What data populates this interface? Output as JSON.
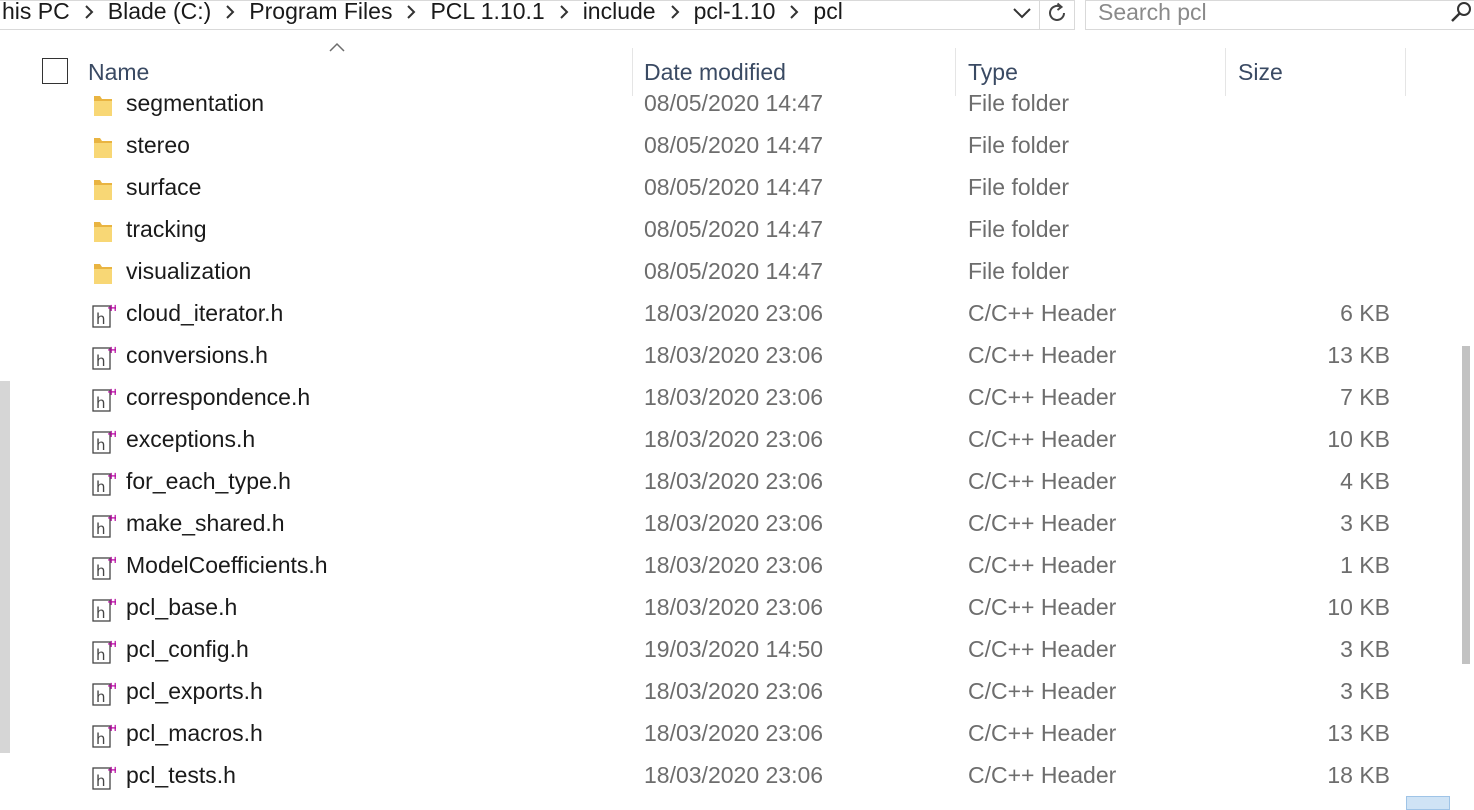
{
  "address_bar": {
    "breadcrumbs": [
      "his PC",
      "Blade (C:)",
      "Program Files",
      "PCL 1.10.1",
      "include",
      "pcl-1.10",
      "pcl"
    ]
  },
  "search": {
    "placeholder": "Search pcl"
  },
  "columns": {
    "name": "Name",
    "date_modified": "Date modified",
    "type": "Type",
    "size": "Size"
  },
  "icons": {
    "folder": "folder-icon",
    "header_file": "cpp-header-file-icon",
    "refresh": "refresh-icon",
    "dropdown": "chevron-down-icon",
    "search": "search-icon",
    "breadcrumb_separator": "chevron-right-icon",
    "sort": "sort-ascending-icon"
  },
  "colors": {
    "folder_yellow": "#f8d775",
    "header_text": "#3a4a63",
    "secondary_text": "#6d6d6d",
    "cpp_plus": "#b4009e"
  },
  "files": [
    {
      "name": "segmentation",
      "date": "08/05/2020 14:47",
      "type": "File folder",
      "size": "",
      "kind": "folder"
    },
    {
      "name": "stereo",
      "date": "08/05/2020 14:47",
      "type": "File folder",
      "size": "",
      "kind": "folder"
    },
    {
      "name": "surface",
      "date": "08/05/2020 14:47",
      "type": "File folder",
      "size": "",
      "kind": "folder"
    },
    {
      "name": "tracking",
      "date": "08/05/2020 14:47",
      "type": "File folder",
      "size": "",
      "kind": "folder"
    },
    {
      "name": "visualization",
      "date": "08/05/2020 14:47",
      "type": "File folder",
      "size": "",
      "kind": "folder"
    },
    {
      "name": "cloud_iterator.h",
      "date": "18/03/2020 23:06",
      "type": "C/C++ Header",
      "size": "6 KB",
      "kind": "header"
    },
    {
      "name": "conversions.h",
      "date": "18/03/2020 23:06",
      "type": "C/C++ Header",
      "size": "13 KB",
      "kind": "header"
    },
    {
      "name": "correspondence.h",
      "date": "18/03/2020 23:06",
      "type": "C/C++ Header",
      "size": "7 KB",
      "kind": "header"
    },
    {
      "name": "exceptions.h",
      "date": "18/03/2020 23:06",
      "type": "C/C++ Header",
      "size": "10 KB",
      "kind": "header"
    },
    {
      "name": "for_each_type.h",
      "date": "18/03/2020 23:06",
      "type": "C/C++ Header",
      "size": "4 KB",
      "kind": "header"
    },
    {
      "name": "make_shared.h",
      "date": "18/03/2020 23:06",
      "type": "C/C++ Header",
      "size": "3 KB",
      "kind": "header"
    },
    {
      "name": "ModelCoefficients.h",
      "date": "18/03/2020 23:06",
      "type": "C/C++ Header",
      "size": "1 KB",
      "kind": "header"
    },
    {
      "name": "pcl_base.h",
      "date": "18/03/2020 23:06",
      "type": "C/C++ Header",
      "size": "10 KB",
      "kind": "header"
    },
    {
      "name": "pcl_config.h",
      "date": "19/03/2020 14:50",
      "type": "C/C++ Header",
      "size": "3 KB",
      "kind": "header"
    },
    {
      "name": "pcl_exports.h",
      "date": "18/03/2020 23:06",
      "type": "C/C++ Header",
      "size": "3 KB",
      "kind": "header"
    },
    {
      "name": "pcl_macros.h",
      "date": "18/03/2020 23:06",
      "type": "C/C++ Header",
      "size": "13 KB",
      "kind": "header"
    },
    {
      "name": "pcl_tests.h",
      "date": "18/03/2020 23:06",
      "type": "C/C++ Header",
      "size": "18 KB",
      "kind": "header"
    }
  ]
}
